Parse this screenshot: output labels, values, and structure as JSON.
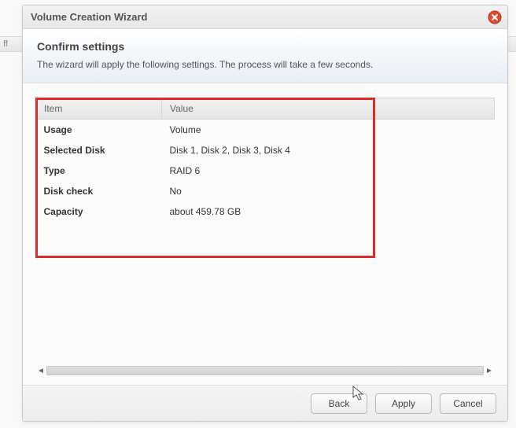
{
  "backdrop_hint": "ff",
  "dialog": {
    "title": "Volume Creation Wizard",
    "headline": "Confirm settings",
    "subtext": "The wizard will apply the following settings. The process will take a few seconds."
  },
  "table": {
    "columns": [
      "Item",
      "Value"
    ],
    "rows": [
      {
        "key": "Usage",
        "value": "Volume"
      },
      {
        "key": "Selected Disk",
        "value": "Disk 1, Disk 2, Disk 3, Disk 4"
      },
      {
        "key": "Type",
        "value": "RAID 6"
      },
      {
        "key": "Disk check",
        "value": "No"
      },
      {
        "key": "Capacity",
        "value": "about 459.78 GB"
      }
    ]
  },
  "buttons": {
    "back": "Back",
    "apply": "Apply",
    "cancel": "Cancel"
  }
}
